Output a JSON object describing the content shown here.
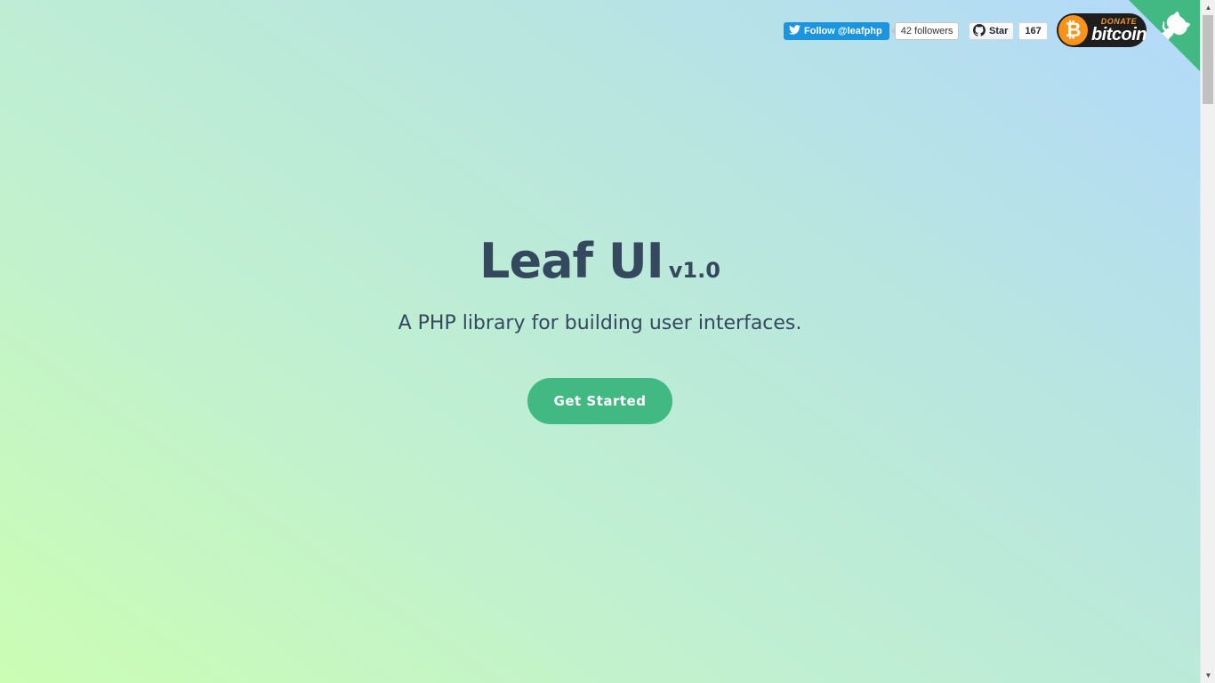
{
  "header": {
    "twitter": {
      "follow_label": "Follow @leafphp",
      "followers": "42 followers",
      "icon": "twitter-bird-icon"
    },
    "github": {
      "star_label": "Star",
      "star_count": "167",
      "icon": "github-icon"
    },
    "bitcoin": {
      "small_label": "DONATE",
      "big_label": "bitcoin",
      "symbol": "₿",
      "icon": "bitcoin-icon"
    },
    "corner": {
      "icon": "github-octocat-icon",
      "color": "#42b983"
    }
  },
  "hero": {
    "title": "Leaf UI",
    "version": "v1.0",
    "tagline": "A PHP library for building user interfaces.",
    "cta_label": "Get Started"
  },
  "colors": {
    "text": "#34495e",
    "accent": "#42b983",
    "twitter": "#1b95e0",
    "bitcoin": "#f7931a"
  },
  "scrollbar": {
    "up_arrow": "▲",
    "down_arrow": "▼"
  }
}
